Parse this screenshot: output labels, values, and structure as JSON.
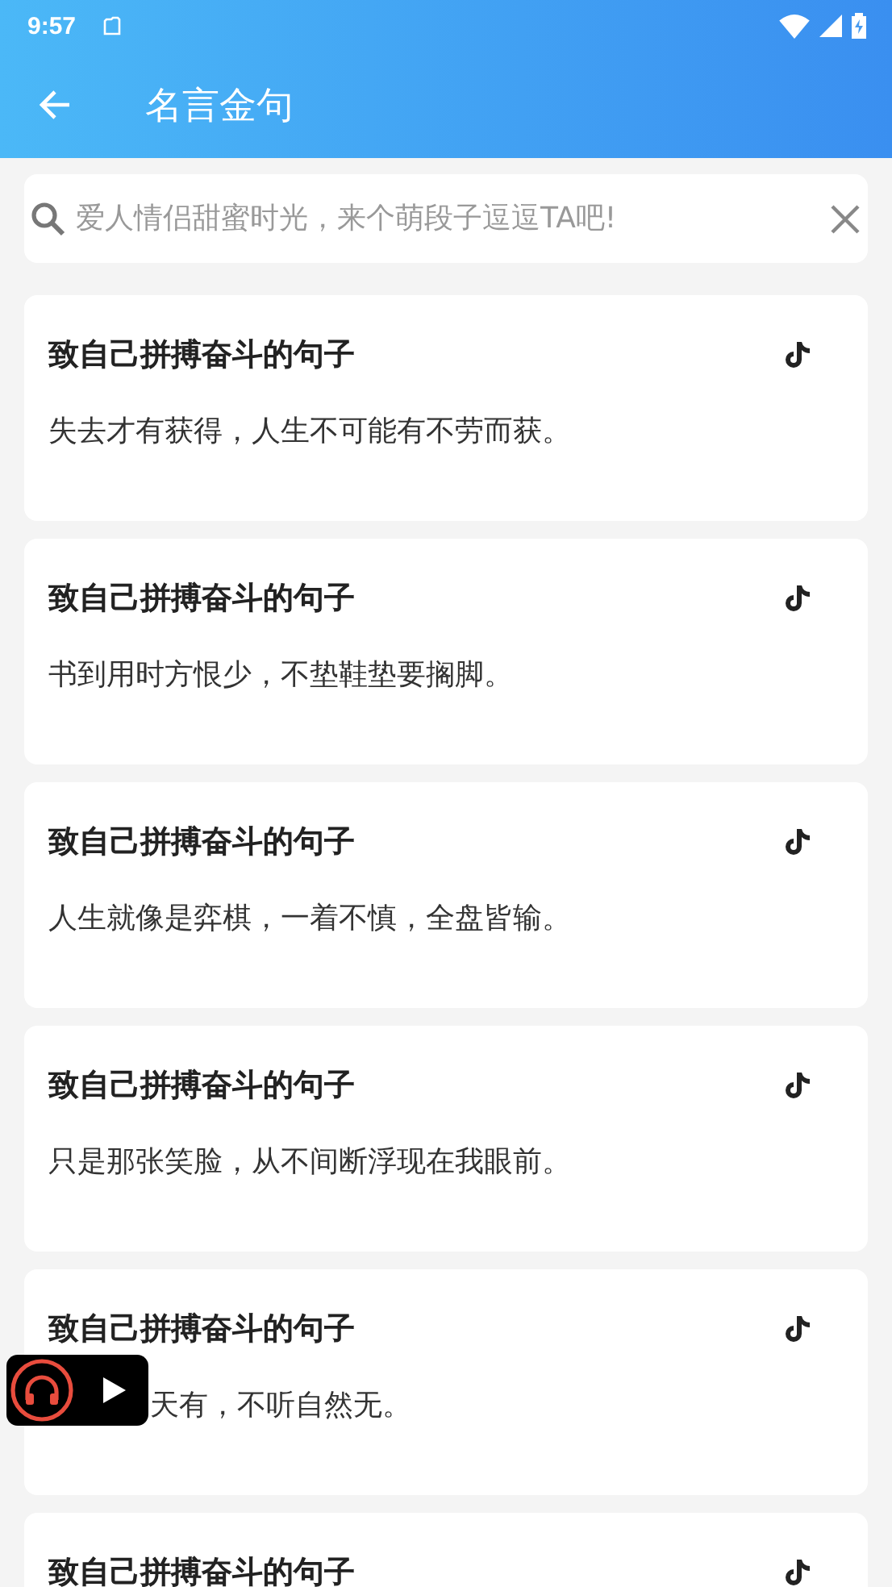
{
  "status_bar": {
    "time": "9:57"
  },
  "app_bar": {
    "title": "名言金句"
  },
  "search": {
    "placeholder": "爱人情侣甜蜜时光，来个萌段子逗逗TA吧!"
  },
  "cards": [
    {
      "title": "致自己拼搏奋斗的句子",
      "text": "失去才有获得，人生不可能有不劳而获。"
    },
    {
      "title": "致自己拼搏奋斗的句子",
      "text": "书到用时方恨少，不垫鞋垫要搁脚。"
    },
    {
      "title": "致自己拼搏奋斗的句子",
      "text": "人生就像是弈棋，一着不慎，全盘皆输。"
    },
    {
      "title": "致自己拼搏奋斗的句子",
      "text": "只是那张笑脸，从不间断浮现在我眼前。"
    },
    {
      "title": "致自己拼搏奋斗的句子",
      "text": "天有，不听自然无。",
      "partly_hidden": true
    },
    {
      "title": "致自己拼搏奋斗的句子"
    }
  ]
}
